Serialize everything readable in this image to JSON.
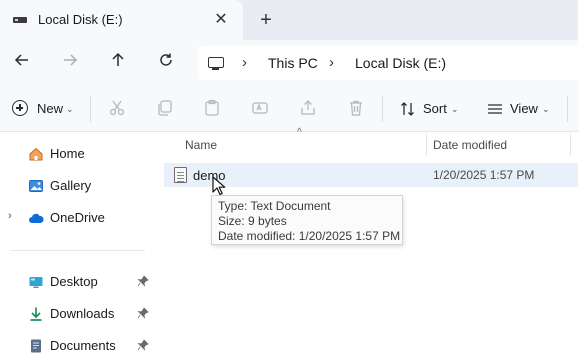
{
  "tab": {
    "title": "Local Disk (E:)",
    "close_icon": "close-icon",
    "new_tab_icon": "plus-icon"
  },
  "nav": {
    "back_icon": "arrow-left-icon",
    "forward_icon": "arrow-right-icon",
    "up_icon": "arrow-up-icon",
    "refresh_icon": "refresh-icon",
    "breadcrumb": [
      "This PC",
      "Local Disk (E:)"
    ]
  },
  "commandbar": {
    "new_label": "New",
    "sort_label": "Sort",
    "view_label": "View",
    "icons": [
      "cut-icon",
      "copy-icon",
      "paste-icon",
      "rename-icon",
      "share-icon",
      "delete-icon"
    ]
  },
  "sidebar": {
    "items": [
      {
        "label": "Home",
        "icon": "home-icon"
      },
      {
        "label": "Gallery",
        "icon": "gallery-icon"
      },
      {
        "label": "OneDrive",
        "icon": "cloud-icon"
      }
    ],
    "pinned": [
      {
        "label": "Desktop",
        "icon": "desktop-folder-icon"
      },
      {
        "label": "Downloads",
        "icon": "downloads-folder-icon"
      },
      {
        "label": "Documents",
        "icon": "documents-folder-icon"
      }
    ]
  },
  "columns": {
    "name": "Name",
    "date_modified": "Date modified"
  },
  "files": [
    {
      "name": "demo",
      "date_modified": "1/20/2025 1:57 PM"
    }
  ],
  "tooltip": {
    "type": "Type: Text Document",
    "size": "Size: 9 bytes",
    "date": "Date modified: 1/20/2025 1:57 PM"
  },
  "colors": {
    "accent": "#0067c0",
    "selection": "#e8f0fa",
    "chrome": "#f7f9fc"
  }
}
